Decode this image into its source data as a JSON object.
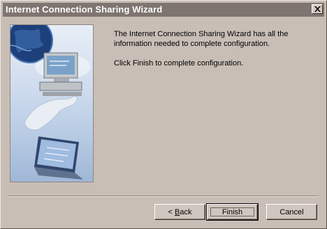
{
  "window": {
    "title": "Internet Connection Sharing Wizard"
  },
  "content": {
    "message_1": "The Internet Connection Sharing Wizard has all the information needed to complete configuration.",
    "message_2": "Click Finish to complete configuration."
  },
  "buttons": {
    "back_prefix": "< ",
    "back_mnemonic": "B",
    "back_rest": "ack",
    "finish": "Finish",
    "cancel": "Cancel"
  },
  "icons": {
    "close": "close-icon",
    "side_image": "wizard-illustration"
  },
  "colors": {
    "titlebar": "#7e7470",
    "dialog_bg": "#c9beb6"
  }
}
